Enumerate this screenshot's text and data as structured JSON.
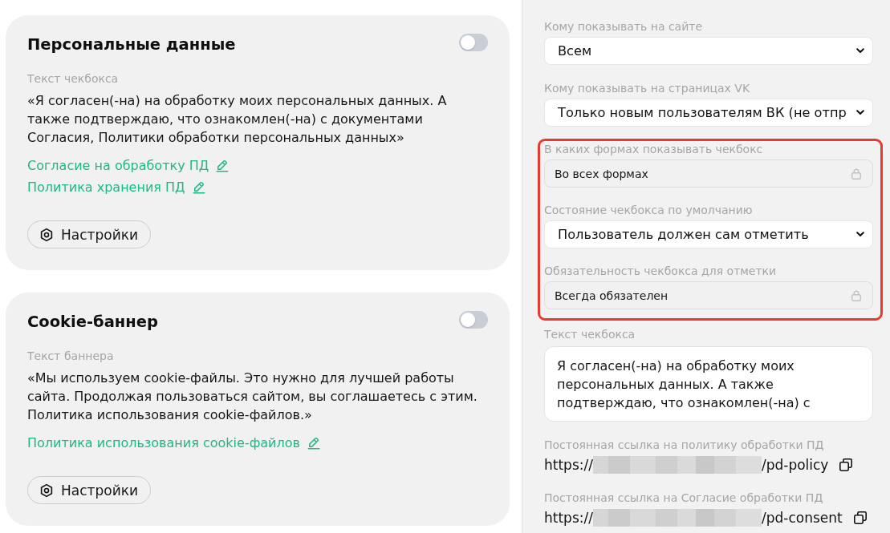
{
  "cards": [
    {
      "title": "Персональные данные",
      "on": false,
      "text_label": "Текст чекбокса",
      "text": "«Я согласен(-на) на обработку моих персональных данных. А также подтверждаю, что ознакомлен(-на) с документами Согласия, Политики обработки персональных данных»",
      "links": [
        "Согласие на обработку ПД",
        "Политика хранения ПД"
      ],
      "button": "Настройки"
    },
    {
      "title": "Cookie-баннер",
      "on": false,
      "text_label": "Текст баннера",
      "text": "«Мы используем cookie-файлы. Это нужно для лучшей работы сайта. Продолжая пользоваться сайтом, вы соглашаетесь с этим. Политика использования cookie-файлов.»",
      "links": [
        "Политика использования cookie-файлов"
      ],
      "button": "Настройки"
    }
  ],
  "settings_panel": {
    "sections": [
      {
        "highlighted": false,
        "fields": [
          {
            "kind": "select",
            "label": "Кому показывать на сайте",
            "value": "Всем"
          },
          {
            "kind": "select",
            "label": "Кому показывать на страницах VK",
            "value": "Только новым пользователям ВК (не отпр"
          }
        ]
      },
      {
        "highlighted": true,
        "fields": [
          {
            "kind": "locked",
            "label": "В каких формах показывать чекбокс",
            "value": "Во всех формах"
          },
          {
            "kind": "select",
            "label": "Состояние чекбокса по умолчанию",
            "value": "Пользователь должен сам отметить"
          },
          {
            "kind": "locked",
            "label": "Обязательность чекбокса для отметки",
            "value": "Всегда обязателен"
          }
        ]
      },
      {
        "highlighted": false,
        "fields": [
          {
            "kind": "textarea",
            "label": "Текст чекбокса",
            "value": "Я согласен(-на) на обработку моих персональных данных. А также подтверждаю, что ознакомлен(-на) с"
          },
          {
            "kind": "link",
            "label": "Постоянная ссылка на политику обработки ПД",
            "prefix": "https://",
            "redacted": true,
            "suffix": "/pd-policy"
          },
          {
            "kind": "link",
            "label": "Постоянная ссылка на Согласие обработки ПД",
            "prefix": "https://",
            "redacted": true,
            "suffix": "/pd-consent"
          }
        ]
      }
    ]
  }
}
